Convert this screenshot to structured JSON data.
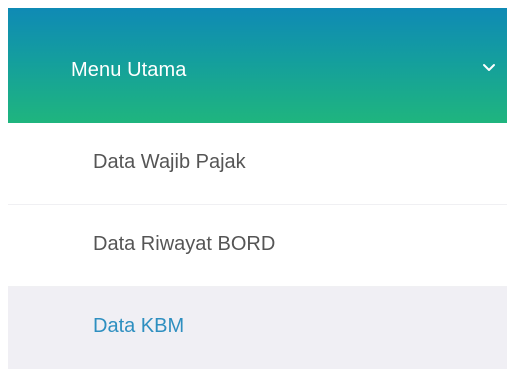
{
  "menu": {
    "title": "Menu Utama",
    "expanded": true,
    "header_gradient": [
      "#0f8ab5",
      "#1fb57e"
    ],
    "items": [
      {
        "label": "Data Wajib Pajak",
        "active": false
      },
      {
        "label": "Data Riwayat BORD",
        "active": false
      },
      {
        "label": "Data KBM",
        "active": true
      }
    ],
    "active_color": "#2e8fc0",
    "chevron_icon": "chevron-down-icon"
  }
}
